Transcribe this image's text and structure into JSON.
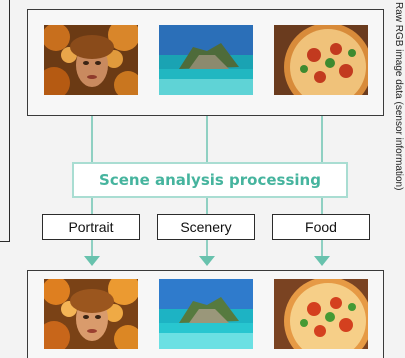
{
  "scene_box": {
    "label": "Scene analysis processing"
  },
  "categories": [
    {
      "label": "Portrait"
    },
    {
      "label": "Scenery"
    },
    {
      "label": "Food"
    }
  ],
  "images": {
    "top": [
      "portrait-image",
      "scenery-image",
      "food-image"
    ],
    "bottom": [
      "portrait-image",
      "scenery-image",
      "food-image"
    ]
  },
  "side_caption": {
    "text": "Raw RGB image data (sensor information)"
  },
  "colors": {
    "accent_text": "#46b49e",
    "accent_border": "#a9ddd2",
    "arrow": "#68c2ad",
    "line": "#8fd0c2",
    "panel_border": "#3a3a3a"
  }
}
